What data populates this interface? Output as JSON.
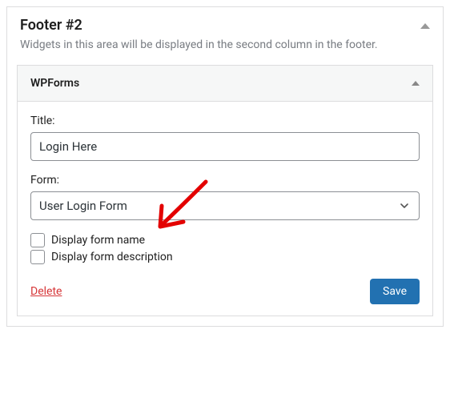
{
  "area": {
    "title": "Footer #2",
    "description": "Widgets in this area will be displayed in the second column in the footer."
  },
  "widget": {
    "name": "WPForms",
    "title_label": "Title:",
    "title_value": "Login Here",
    "form_label": "Form:",
    "form_value": "User Login Form",
    "checkbox_name": "Display form name",
    "checkbox_desc": "Display form description",
    "delete_label": "Delete",
    "save_label": "Save"
  }
}
